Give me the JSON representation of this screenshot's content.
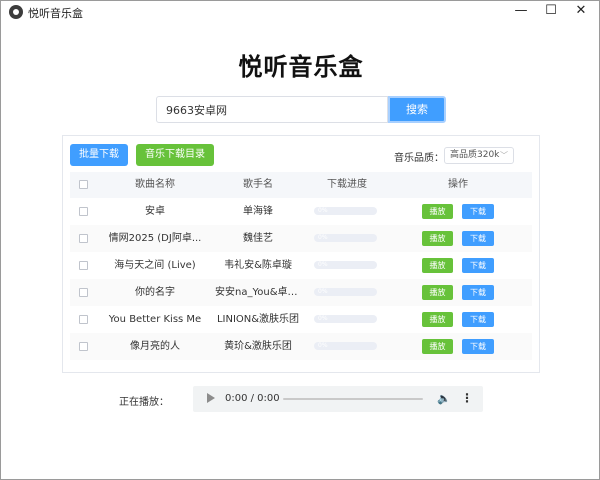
{
  "window": {
    "title": "悦听音乐盒",
    "minimize": "—",
    "maximize": "☐",
    "close": "✕"
  },
  "header": {
    "title": "悦听音乐盒"
  },
  "search": {
    "value": "9663安卓网",
    "button": "搜索"
  },
  "toolbar": {
    "batch_download": "批量下载",
    "download_dir": "音乐下载目录",
    "quality_label": "音乐品质：",
    "quality_value": "高品质320k"
  },
  "table": {
    "headers": {
      "name": "歌曲名称",
      "artist": "歌手名",
      "progress": "下载进度",
      "actions": "操作"
    },
    "play_label": "播放",
    "download_label": "下载",
    "rows": [
      {
        "name": "安卓",
        "artist": "单海锋",
        "progress": "0%"
      },
      {
        "name": "情网2025 (DJ阿卓...",
        "artist": "魏佳艺",
        "progress": "0%"
      },
      {
        "name": "海与天之间 (Live)",
        "artist": "韦礼安&陈卓璇",
        "progress": "0%"
      },
      {
        "name": "你的名字",
        "artist": "安安na_You&卓文...",
        "progress": "0%"
      },
      {
        "name": "You Better Kiss Me",
        "artist": "LINION&激肤乐团",
        "progress": "0%"
      },
      {
        "name": "像月亮的人",
        "artist": "黄玠&激肤乐团",
        "progress": "0%"
      }
    ]
  },
  "player": {
    "label": "正在播放：",
    "time": "0:00 / 0:00"
  },
  "colors": {
    "primary": "#409eff",
    "success": "#67c23a",
    "header_bg": "#f5f7fa"
  }
}
